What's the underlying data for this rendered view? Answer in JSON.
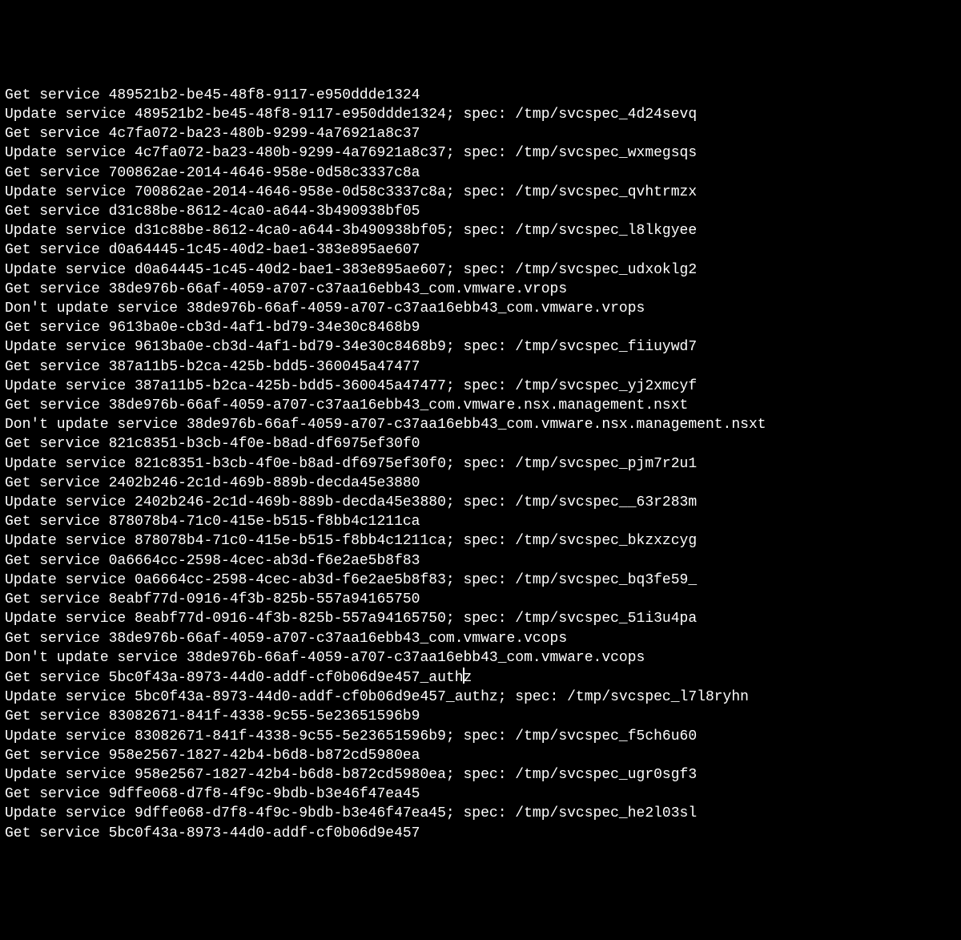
{
  "cursor_line_index": 30,
  "cursor_after_text": true,
  "lines": [
    "Get service 489521b2-be45-48f8-9117-e950ddde1324",
    "Update service 489521b2-be45-48f8-9117-e950ddde1324; spec: /tmp/svcspec_4d24sevq",
    "Get service 4c7fa072-ba23-480b-9299-4a76921a8c37",
    "Update service 4c7fa072-ba23-480b-9299-4a76921a8c37; spec: /tmp/svcspec_wxmegsqs",
    "Get service 700862ae-2014-4646-958e-0d58c3337c8a",
    "Update service 700862ae-2014-4646-958e-0d58c3337c8a; spec: /tmp/svcspec_qvhtrmzx",
    "Get service d31c88be-8612-4ca0-a644-3b490938bf05",
    "Update service d31c88be-8612-4ca0-a644-3b490938bf05; spec: /tmp/svcspec_l8lkgyee",
    "Get service d0a64445-1c45-40d2-bae1-383e895ae607",
    "Update service d0a64445-1c45-40d2-bae1-383e895ae607; spec: /tmp/svcspec_udxoklg2",
    "Get service 38de976b-66af-4059-a707-c37aa16ebb43_com.vmware.vrops",
    "Don't update service 38de976b-66af-4059-a707-c37aa16ebb43_com.vmware.vrops",
    "Get service 9613ba0e-cb3d-4af1-bd79-34e30c8468b9",
    "Update service 9613ba0e-cb3d-4af1-bd79-34e30c8468b9; spec: /tmp/svcspec_fiiuywd7",
    "Get service 387a11b5-b2ca-425b-bdd5-360045a47477",
    "Update service 387a11b5-b2ca-425b-bdd5-360045a47477; spec: /tmp/svcspec_yj2xmcyf",
    "Get service 38de976b-66af-4059-a707-c37aa16ebb43_com.vmware.nsx.management.nsxt",
    "Don't update service 38de976b-66af-4059-a707-c37aa16ebb43_com.vmware.nsx.management.nsxt",
    "Get service 821c8351-b3cb-4f0e-b8ad-df6975ef30f0",
    "Update service 821c8351-b3cb-4f0e-b8ad-df6975ef30f0; spec: /tmp/svcspec_pjm7r2u1",
    "Get service 2402b246-2c1d-469b-889b-decda45e3880",
    "Update service 2402b246-2c1d-469b-889b-decda45e3880; spec: /tmp/svcspec__63r283m",
    "Get service 878078b4-71c0-415e-b515-f8bb4c1211ca",
    "Update service 878078b4-71c0-415e-b515-f8bb4c1211ca; spec: /tmp/svcspec_bkzxzcyg",
    "Get service 0a6664cc-2598-4cec-ab3d-f6e2ae5b8f83",
    "Update service 0a6664cc-2598-4cec-ab3d-f6e2ae5b8f83; spec: /tmp/svcspec_bq3fe59_",
    "Get service 8eabf77d-0916-4f3b-825b-557a94165750",
    "Update service 8eabf77d-0916-4f3b-825b-557a94165750; spec: /tmp/svcspec_51i3u4pa",
    "Get service 38de976b-66af-4059-a707-c37aa16ebb43_com.vmware.vcops",
    "Don't update service 38de976b-66af-4059-a707-c37aa16ebb43_com.vmware.vcops",
    "Get service 5bc0f43a-8973-44d0-addf-cf0b06d9e457_authz",
    "Update service 5bc0f43a-8973-44d0-addf-cf0b06d9e457_authz; spec: /tmp/svcspec_l7l8ryhn",
    "Get service 83082671-841f-4338-9c55-5e23651596b9",
    "Update service 83082671-841f-4338-9c55-5e23651596b9; spec: /tmp/svcspec_f5ch6u60",
    "Get service 958e2567-1827-42b4-b6d8-b872cd5980ea",
    "Update service 958e2567-1827-42b4-b6d8-b872cd5980ea; spec: /tmp/svcspec_ugr0sgf3",
    "Get service 9dffe068-d7f8-4f9c-9bdb-b3e46f47ea45",
    "Update service 9dffe068-d7f8-4f9c-9bdb-b3e46f47ea45; spec: /tmp/svcspec_he2l03sl",
    "Get service 5bc0f43a-8973-44d0-addf-cf0b06d9e457"
  ]
}
